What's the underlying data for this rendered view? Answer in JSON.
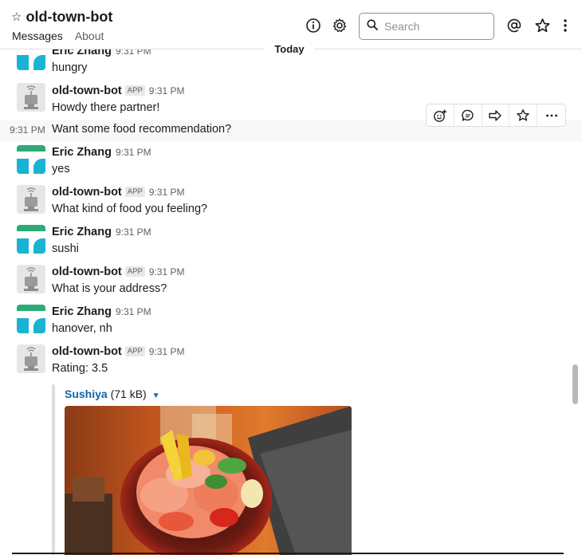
{
  "header": {
    "channel_title": "old-town-bot",
    "tabs": [
      {
        "label": "Messages"
      },
      {
        "label": "About"
      }
    ],
    "search_placeholder": "Search"
  },
  "divider": {
    "label": "Today"
  },
  "messages": [
    {
      "author": "Eric Zhang",
      "time": "9:31 PM",
      "text": "hungry"
    },
    {
      "author": "old-town-bot",
      "badge": "APP",
      "time": "9:31 PM",
      "text": "Howdy there partner!"
    },
    {
      "time": "9:31 PM",
      "text": "Want some food recommendation?"
    },
    {
      "author": "Eric Zhang",
      "time": "9:31 PM",
      "text": "yes"
    },
    {
      "author": "old-town-bot",
      "badge": "APP",
      "time": "9:31 PM",
      "text": "What kind of food you feeling?"
    },
    {
      "author": "Eric Zhang",
      "time": "9:31 PM",
      "text": "sushi"
    },
    {
      "author": "old-town-bot",
      "badge": "APP",
      "time": "9:31 PM",
      "text": "What is your address?"
    },
    {
      "author": "Eric Zhang",
      "time": "9:31 PM",
      "text": "hanover, nh"
    },
    {
      "author": "old-town-bot",
      "badge": "APP",
      "time": "9:31 PM",
      "text": "Rating: 3.5"
    }
  ],
  "attachment": {
    "name": "Sushiya",
    "size": "(71 kB)"
  },
  "icons": {
    "star_outline": "star-icon",
    "info": "info-icon",
    "gear": "gear-icon",
    "search": "search-icon",
    "mention": "at-sign-icon",
    "more": "vertical-dots-icon",
    "reaction": "add-reaction-icon",
    "thread": "thread-icon",
    "share": "share-icon",
    "bookmark": "star-icon",
    "actions": "more-actions-icon"
  },
  "colors": {
    "link": "#1264a3",
    "user_avatar_green": "#2bac76",
    "user_avatar_teal": "#1ab3d3"
  }
}
